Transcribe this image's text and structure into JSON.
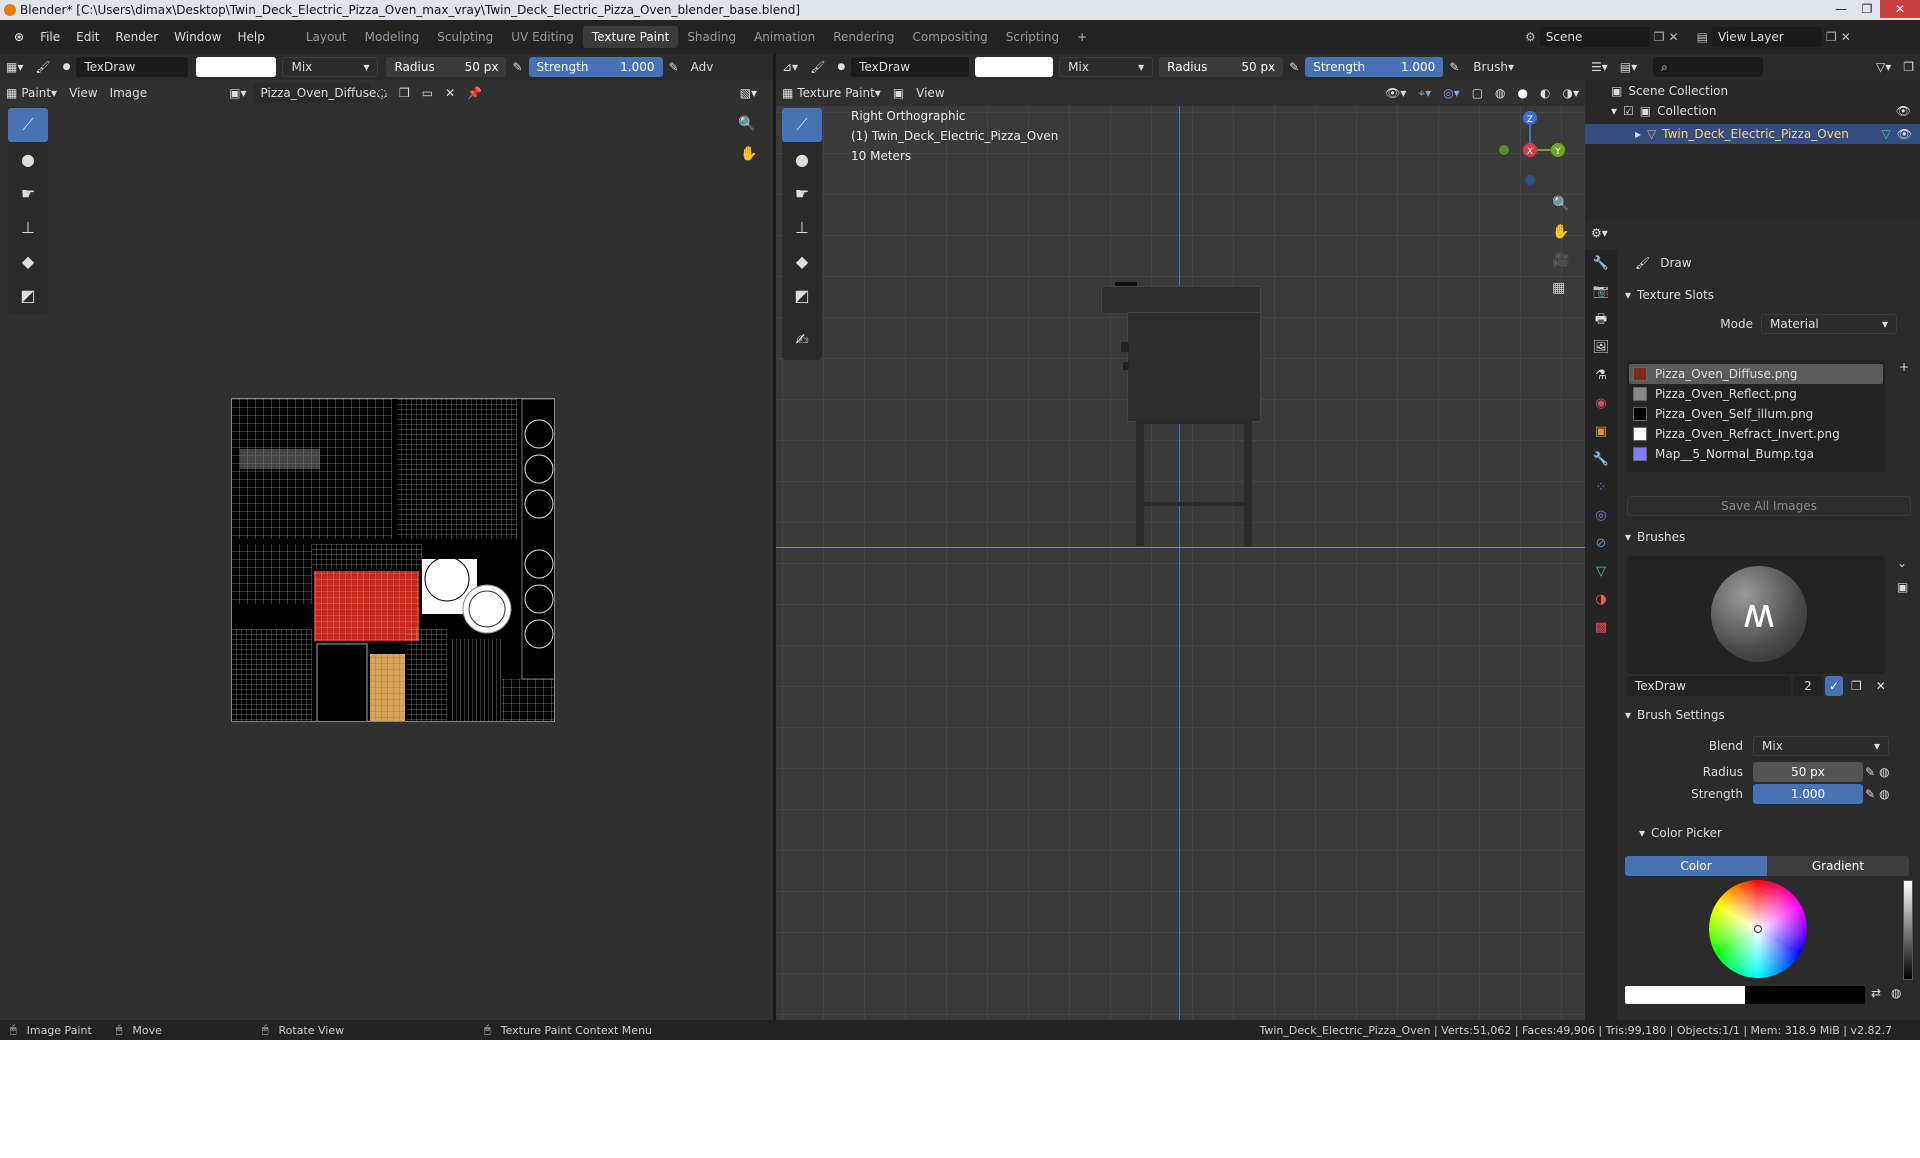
{
  "window": {
    "title": "Blender* [C:\\Users\\dimax\\Desktop\\Twin_Deck_Electric_Pizza_Oven_max_vray\\Twin_Deck_Electric_Pizza_Oven_blender_base.blend]",
    "min": "—",
    "max": "❐",
    "close": "✕"
  },
  "menu": [
    "File",
    "Edit",
    "Render",
    "Window",
    "Help"
  ],
  "workspaces": [
    {
      "label": "Layout",
      "active": false
    },
    {
      "label": "Modeling",
      "active": false
    },
    {
      "label": "Sculpting",
      "active": false
    },
    {
      "label": "UV Editing",
      "active": false
    },
    {
      "label": "Texture Paint",
      "active": true
    },
    {
      "label": "Shading",
      "active": false
    },
    {
      "label": "Animation",
      "active": false
    },
    {
      "label": "Rendering",
      "active": false
    },
    {
      "label": "Compositing",
      "active": false
    },
    {
      "label": "Scripting",
      "active": false
    }
  ],
  "scene": {
    "name": "Scene",
    "view_layer": "View Layer"
  },
  "image_editor": {
    "brush_name": "TexDraw",
    "blend": "Mix",
    "radius_label": "Radius",
    "radius_value": "50 px",
    "strength_label": "Strength",
    "strength_value": "1.000",
    "adv": "Adv",
    "mode": "Paint",
    "view": "View",
    "image": "Image",
    "image_name": "Pizza_Oven_Diffuse..."
  },
  "viewport": {
    "brush_name": "TexDraw",
    "blend": "Mix",
    "radius_label": "Radius",
    "radius_value": "50 px",
    "strength_label": "Strength",
    "strength_value": "1.000",
    "brush_menu": "Brush",
    "mode": "Texture Paint",
    "view": "View",
    "overlay_line1": "Right Orthographic",
    "overlay_line2": "(1) Twin_Deck_Electric_Pizza_Oven",
    "overlay_line3": "10 Meters",
    "gizmo": {
      "z": "Z",
      "x": "X",
      "y": "Y"
    }
  },
  "outliner": {
    "root": "Scene Collection",
    "collection": "Collection",
    "object": "Twin_Deck_Electric_Pizza_Oven"
  },
  "properties": {
    "tool_name": "Draw",
    "texture_slots_title": "Texture Slots",
    "mode_label": "Mode",
    "mode_value": "Material",
    "slots": [
      {
        "name": "Pizza_Oven_Diffuse.png",
        "color": "#7a2a1a",
        "selected": true
      },
      {
        "name": "Pizza_Oven_Reflect.png",
        "color": "#888888",
        "selected": false
      },
      {
        "name": "Pizza_Oven_Self_illum.png",
        "color": "#000000",
        "selected": false
      },
      {
        "name": "Pizza_Oven_Refract_Invert.png",
        "color": "#ffffff",
        "selected": false
      },
      {
        "name": "Map__5_Normal_Bump.tga",
        "color": "#8080ff",
        "selected": false
      }
    ],
    "save_all": "Save All Images",
    "brushes_title": "Brushes",
    "brush_name": "TexDraw",
    "brush_users": "2",
    "brush_settings_title": "Brush Settings",
    "blend_label": "Blend",
    "blend_value": "Mix",
    "radius_label": "Radius",
    "radius_value": "50 px",
    "strength_label": "Strength",
    "strength_value": "1.000",
    "color_picker_title": "Color Picker",
    "tab_color": "Color",
    "tab_gradient": "Gradient"
  },
  "status": {
    "left1": "Image Paint",
    "left2": "Move",
    "left3": "Rotate View",
    "left4": "Texture Paint Context Menu",
    "right": "Twin_Deck_Electric_Pizza_Oven | Verts:51,062 | Faces:49,906 | Tris:99,180 | Objects:1/1 | Mem: 318.9 MiB | v2.82.7"
  },
  "colors": {
    "accent": "#4772b3",
    "bg": "#303030",
    "header": "#2b2b2b"
  }
}
